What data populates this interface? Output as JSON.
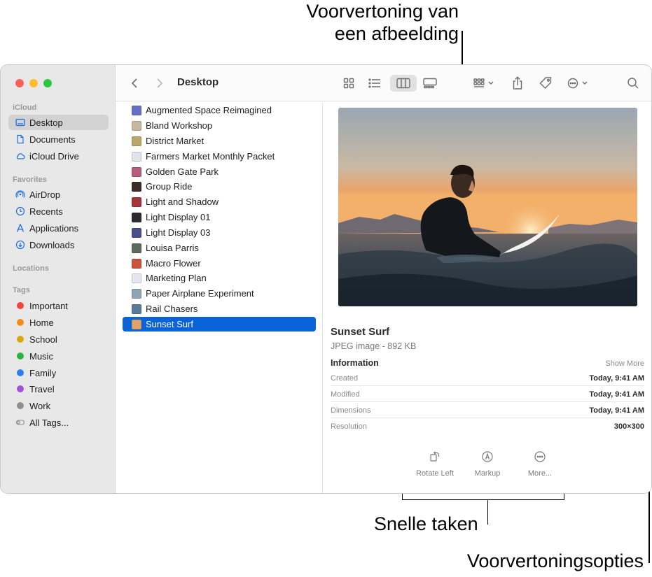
{
  "callouts": {
    "preview_line1": "Voorvertoning van",
    "preview_line2": "een afbeelding",
    "quick_actions": "Snelle taken",
    "preview_options": "Voorvertoningsopties"
  },
  "window": {
    "title": "Desktop"
  },
  "sidebar": {
    "sections": {
      "icloud": "iCloud",
      "favorites": "Favorites",
      "locations": "Locations",
      "tags": "Tags"
    },
    "icloud_items": [
      {
        "label": "Desktop",
        "icon": "desktop-icon",
        "selected": true
      },
      {
        "label": "Documents",
        "icon": "document-icon"
      },
      {
        "label": "iCloud Drive",
        "icon": "cloud-icon"
      }
    ],
    "favorite_items": [
      {
        "label": "AirDrop",
        "icon": "airdrop-icon"
      },
      {
        "label": "Recents",
        "icon": "clock-icon"
      },
      {
        "label": "Applications",
        "icon": "applications-icon"
      },
      {
        "label": "Downloads",
        "icon": "download-icon"
      }
    ],
    "tags": [
      {
        "label": "Important",
        "color": "#f0463c"
      },
      {
        "label": "Home",
        "color": "#f58a1f"
      },
      {
        "label": "School",
        "color": "#d9a90f"
      },
      {
        "label": "Music",
        "color": "#29b43e"
      },
      {
        "label": "Family",
        "color": "#2f7df0"
      },
      {
        "label": "Travel",
        "color": "#a453d6"
      },
      {
        "label": "Work",
        "color": "#8e8e93"
      },
      {
        "label": "All Tags...",
        "color": ""
      }
    ]
  },
  "files": [
    {
      "name": "Augmented Space Reimagined",
      "thumb": "#6470c8"
    },
    {
      "name": "Bland Workshop",
      "thumb": "#c7b79f"
    },
    {
      "name": "District Market",
      "thumb": "#b8a66a"
    },
    {
      "name": "Farmers Market Monthly Packet",
      "thumb": "#dfe3ea"
    },
    {
      "name": "Golden Gate Park",
      "thumb": "#b55d7a"
    },
    {
      "name": "Group Ride",
      "thumb": "#3b2e2a"
    },
    {
      "name": "Light and Shadow",
      "thumb": "#a3363a"
    },
    {
      "name": "Light Display 01",
      "thumb": "#2c2a33"
    },
    {
      "name": "Light Display 03",
      "thumb": "#4a4f8c"
    },
    {
      "name": "Louisa Parris",
      "thumb": "#5c6b5a"
    },
    {
      "name": "Macro Flower",
      "thumb": "#c8553d"
    },
    {
      "name": "Marketing Plan",
      "thumb": "#e4e6ee"
    },
    {
      "name": "Paper Airplane Experiment",
      "thumb": "#8ea6b3"
    },
    {
      "name": "Rail Chasers",
      "thumb": "#5a7a9a"
    },
    {
      "name": "Sunset Surf",
      "thumb": "#e0a36a",
      "selected": true
    }
  ],
  "preview": {
    "name": "Sunset Surf",
    "kind": "JPEG image - 892 KB",
    "info_heading": "Information",
    "show_more": "Show More",
    "rows": [
      {
        "label": "Created",
        "value": "Today, 9:41 AM"
      },
      {
        "label": "Modified",
        "value": "Today, 9:41 AM"
      },
      {
        "label": "Dimensions",
        "value": "Today, 9:41 AM"
      },
      {
        "label": "Resolution",
        "value": "300×300"
      }
    ],
    "actions": [
      {
        "label": "Rotate Left",
        "icon": "rotate-left-icon"
      },
      {
        "label": "Markup",
        "icon": "markup-icon"
      },
      {
        "label": "More...",
        "icon": "more-icon"
      }
    ]
  }
}
